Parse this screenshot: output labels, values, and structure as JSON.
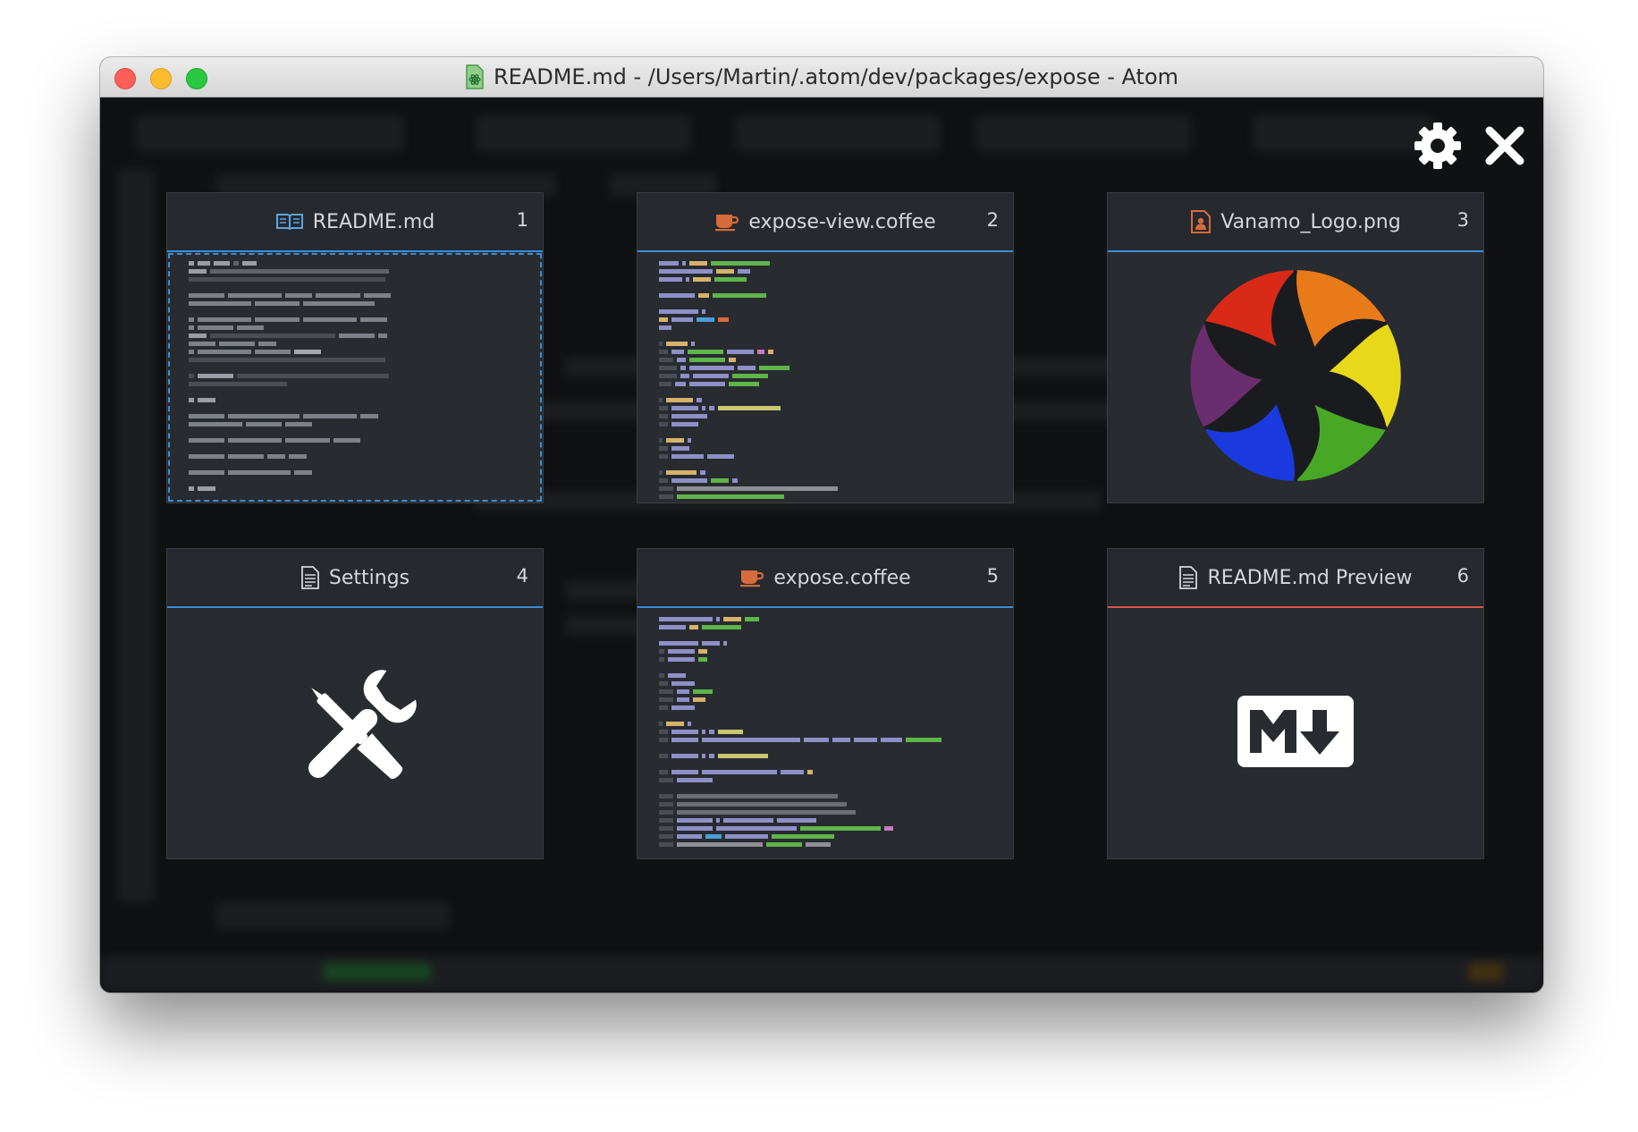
{
  "window": {
    "title": "README.md - /Users/Martin/.atom/dev/packages/expose - Atom",
    "title_icon": "atom-file-icon"
  },
  "controls": {
    "settings_icon": "gear-icon",
    "close_icon": "close-icon"
  },
  "tiles": [
    {
      "title": "README.md",
      "number": "1",
      "icon": "book-icon",
      "icon_color": "#5aa6e8",
      "accent": "#3a8ed8",
      "selected": true
    },
    {
      "title": "expose-view.coffee",
      "number": "2",
      "icon": "coffee-icon",
      "icon_color": "#d66b3b",
      "accent": "#3a8ed8"
    },
    {
      "title": "Vanamo_Logo.png",
      "number": "3",
      "icon": "image-file-icon",
      "icon_color": "#d66b3b",
      "accent": "#3a8ed8"
    },
    {
      "title": "Settings",
      "number": "4",
      "icon": "file-text-icon",
      "icon_color": "#d4d7dc",
      "accent": "#3a8ed8"
    },
    {
      "title": "expose.coffee",
      "number": "5",
      "icon": "coffee-icon",
      "icon_color": "#d66b3b",
      "accent": "#3a8ed8"
    },
    {
      "title": "README.md Preview",
      "number": "6",
      "icon": "file-text-icon",
      "icon_color": "#d4d7dc",
      "accent": "#d8564a"
    }
  ],
  "colors": {
    "tab_accent": "#3a8ed8",
    "preview_accent": "#d8564a",
    "tile_bg": "#282b30",
    "workspace_bg": "#101112"
  }
}
